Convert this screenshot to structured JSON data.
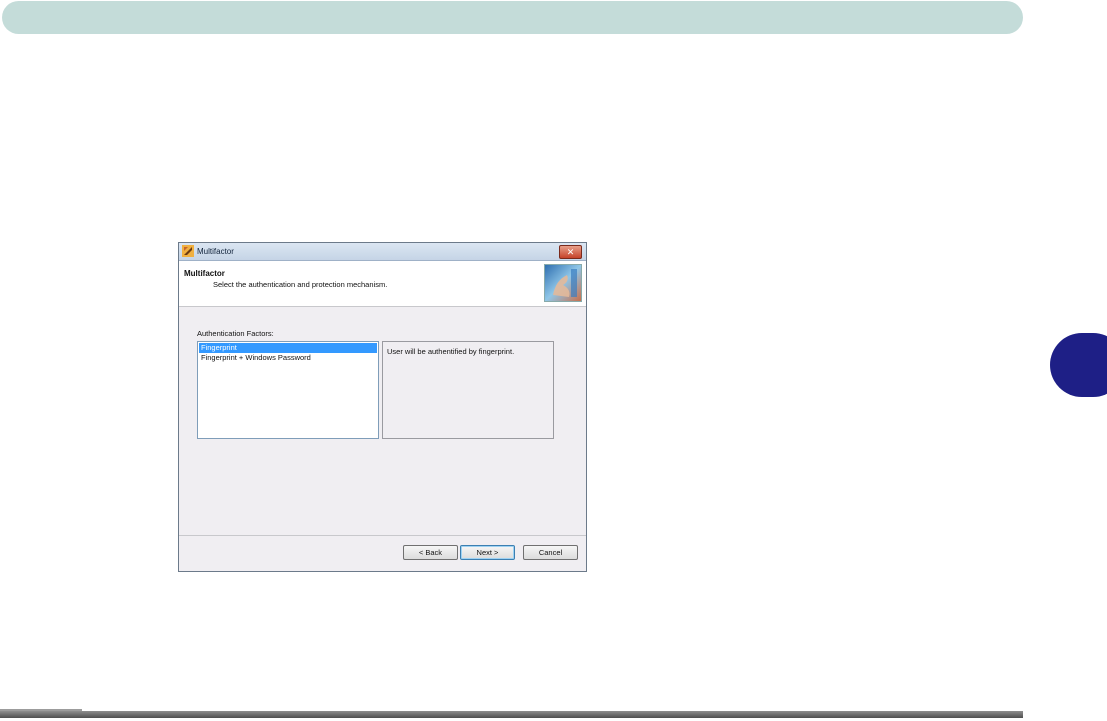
{
  "dialog": {
    "title": "Multifactor",
    "header_title": "Multifactor",
    "header_subtitle": "Select the authentication and protection mechanism.",
    "close_glyph": "✕",
    "factors_label": "Authentication Factors:",
    "factors": [
      {
        "label": "Fingerprint",
        "selected": true
      },
      {
        "label": "Fingerprint + Windows Password",
        "selected": false
      }
    ],
    "description": "User will be authentified by fingerprint.",
    "buttons": {
      "back": "< Back",
      "next": "Next >",
      "cancel": "Cancel"
    }
  },
  "colors": {
    "top_bar": "#c4dcd9",
    "side_tab": "#1e1f86",
    "selection": "#3399ff"
  }
}
